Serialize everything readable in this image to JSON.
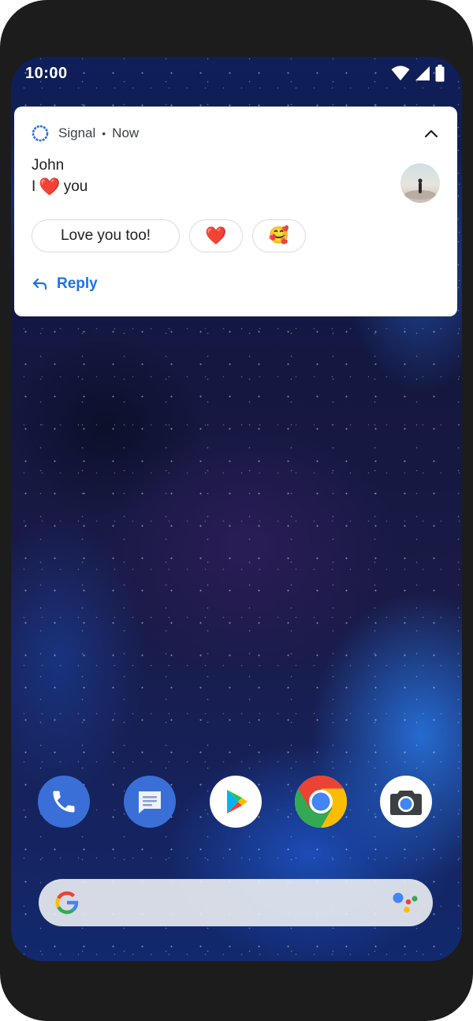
{
  "status_bar": {
    "time": "10:00",
    "icons": [
      "wifi-icon",
      "cellular-signal-icon",
      "battery-icon"
    ]
  },
  "notification": {
    "app_name": "Signal",
    "separator": "•",
    "timestamp": "Now",
    "app_icon": "signal-icon",
    "collapse_icon": "chevron-up-icon",
    "title": "John",
    "message_prefix": "I",
    "message_emoji": "❤️",
    "message_suffix": "you",
    "smart_replies": [
      "Love you too!",
      "❤️",
      "🥰"
    ],
    "reply_label": "Reply",
    "reply_icon": "reply-arrow-icon",
    "accent_color": "#1a73e8"
  },
  "dock": {
    "apps": [
      "phone-app-icon",
      "messages-app-icon",
      "play-store-app-icon",
      "chrome-app-icon",
      "camera-app-icon"
    ]
  },
  "search_bar": {
    "left_icon": "google-g-icon",
    "right_icon": "google-assistant-icon"
  }
}
